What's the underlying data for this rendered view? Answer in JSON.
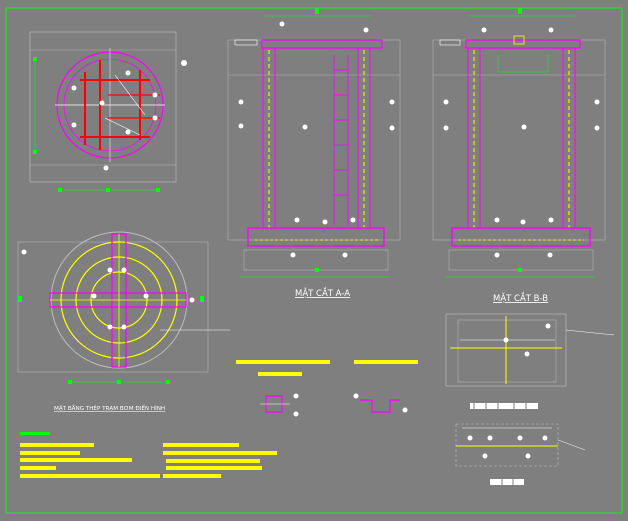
{
  "sections": {
    "section_aa": "MẶT CẮT A-A",
    "section_bb": "MẶT CẮT B-B",
    "plan_title": "MẶT BẰNG THÉP TRẠM BƠM ĐIỂN HÌNH"
  },
  "palette": {
    "background": "#7f7f7f",
    "border": "#00ff00",
    "rebar": "#ff00ff",
    "highlight": "#ffff00",
    "main_bar": "#ff0000",
    "line": "#ffffff"
  }
}
